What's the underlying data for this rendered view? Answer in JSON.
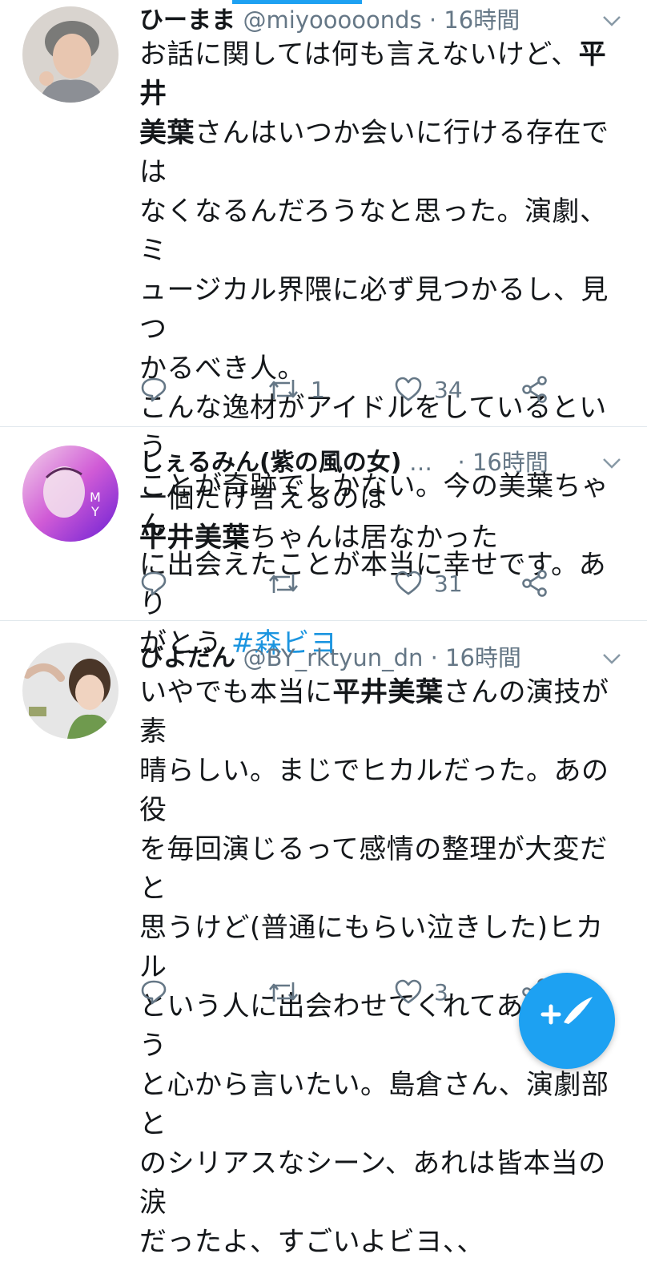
{
  "tweets": [
    {
      "name": "ひーまま",
      "handle": "@miyooooonds",
      "time": "16時間",
      "text_lines": [
        [
          "お話に関しては何も言えないけど、",
          "平井"
        ],
        [
          "美葉",
          "さんはいつか会いに行ける存在では"
        ],
        [
          "なくなるんだろうなと思った。演劇、ミ"
        ],
        [
          "ュージカル界隈に必ず見つかるし、見つ"
        ],
        [
          "かるべき人。"
        ],
        [
          "こんな逸材がアイドルをしているという"
        ],
        [
          "ことが奇跡でしかない。今の美葉ちゃん"
        ],
        [
          "に出会えたことが本当に幸せです。あり"
        ],
        [
          "がとう ",
          "#森ビヨ"
        ]
      ],
      "retweets": "1",
      "likes": "34"
    },
    {
      "name": "しぇるみん(紫の風の女)",
      "ellipsis": "…",
      "handle": "",
      "time": "16時間",
      "text_lines": [
        [
          "一個だけ言えるのは"
        ],
        [
          "平井美葉",
          "ちゃんは居なかった"
        ]
      ],
      "retweets": "",
      "likes": "31"
    },
    {
      "name": "びよだん",
      "handle": "@BY_rktyun_dn",
      "time": "16時間",
      "text_lines": [
        [
          "いやでも本当に",
          "平井美葉",
          "さんの演技が素"
        ],
        [
          "晴らしい。まじでヒカルだった。あの役"
        ],
        [
          "を毎回演じるって感情の整理が大変だと"
        ],
        [
          "思うけど(普通にもらい泣きした)ヒカル"
        ],
        [
          "という人に出会わせてくれてありがとう"
        ],
        [
          "と心から言いたい。島倉さん、演劇部と"
        ],
        [
          "のシリアスなシーン、あれは皆本当の涙"
        ],
        [
          "だったよ、すごいよビヨ、、"
        ]
      ],
      "retweets": "",
      "likes": "3"
    }
  ],
  "meta_separator": " · ",
  "icons": [
    "reply-icon",
    "retweet-icon",
    "like-icon",
    "share-icon",
    "chevron-down-icon",
    "compose-icon"
  ],
  "colors": {
    "accent": "#1da1f2",
    "hashtag": "#1b95e0",
    "meta": "#657786"
  }
}
